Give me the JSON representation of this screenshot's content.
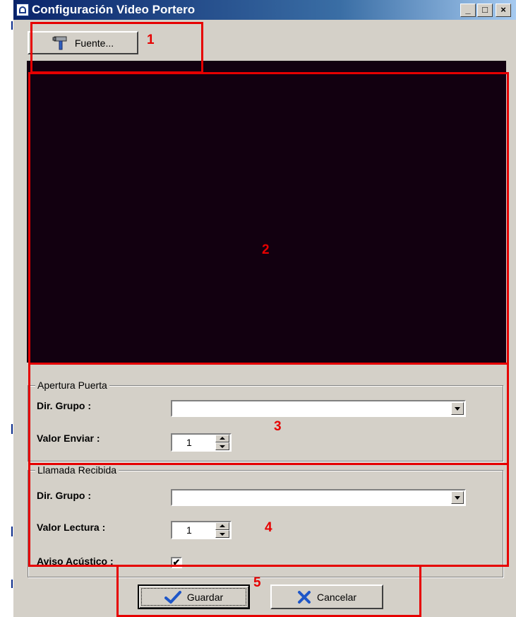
{
  "window": {
    "title": "Configuración Video Portero",
    "controls": {
      "minimize": "_",
      "maximize": "□",
      "close": "×"
    }
  },
  "toolbar": {
    "source_label": "Fuente...",
    "source_icon": "hammer-icon"
  },
  "video_preview": {
    "background": "#120010"
  },
  "door_opening": {
    "legend": "Apertura Puerta",
    "group_label": "Dir. Grupo :",
    "group_value": "",
    "send_label": "Valor Enviar :",
    "send_value": "1"
  },
  "incoming_call": {
    "legend": "Llamada Recibida",
    "group_label": "Dir. Grupo :",
    "group_value": "",
    "read_label": "Valor Lectura :",
    "read_value": "1",
    "acoustic_label": "Aviso Acústico :",
    "acoustic_checked": true,
    "acoustic_mark": "✔"
  },
  "actions": {
    "save_label": "Guardar",
    "save_icon": "checkmark-icon",
    "cancel_label": "Cancelar",
    "cancel_icon": "x-icon"
  },
  "annotations": {
    "color": "#e60000",
    "labels": [
      "1",
      "2",
      "3",
      "4",
      "5"
    ]
  }
}
